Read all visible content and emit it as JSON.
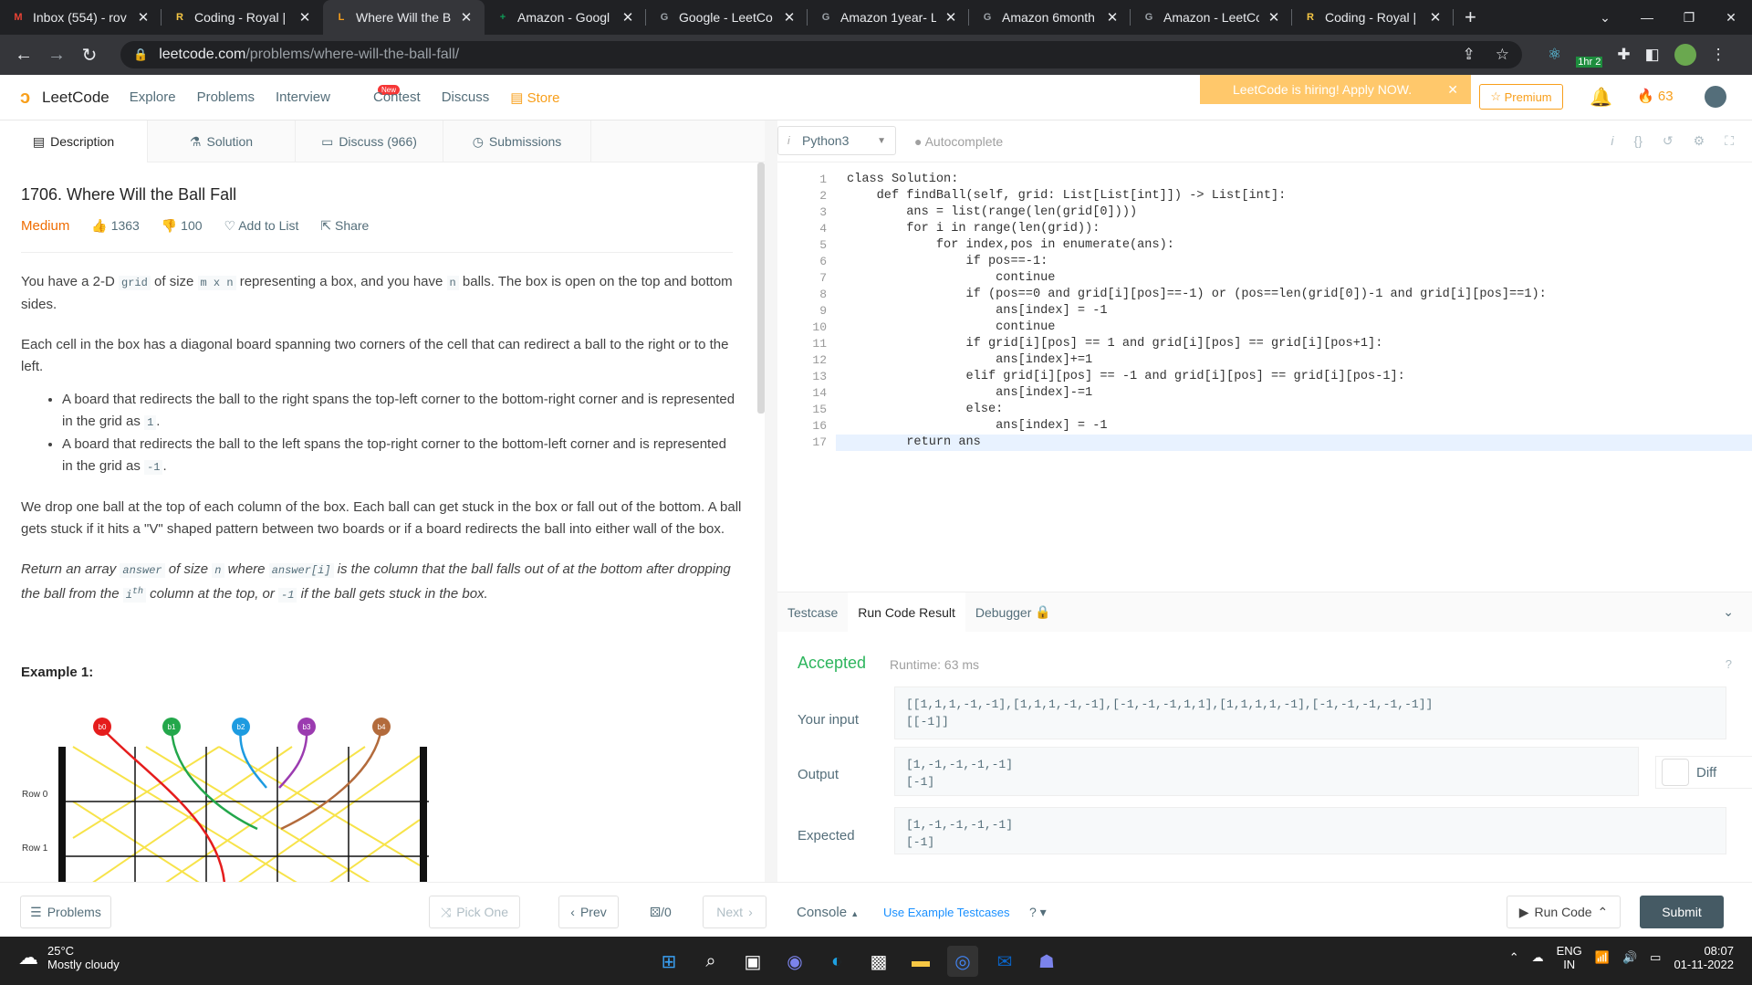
{
  "browser": {
    "tabs": [
      {
        "title": "Inbox (554) - rov",
        "icon": "M",
        "color": "#ea4335"
      },
      {
        "title": "Coding - Royal | ",
        "icon": "R",
        "color": "#f6c744"
      },
      {
        "title": "Where Will the B",
        "icon": "L",
        "color": "#f89f1b"
      },
      {
        "title": "Amazon - Googl",
        "icon": "+",
        "color": "#0f9d58"
      },
      {
        "title": "Google - LeetCo",
        "icon": "G",
        "color": "#9aa0a6"
      },
      {
        "title": "Amazon 1year- L",
        "icon": "G",
        "color": "#9aa0a6"
      },
      {
        "title": "Amazon 6month",
        "icon": "G",
        "color": "#9aa0a6"
      },
      {
        "title": "Amazon - LeetCo",
        "icon": "G",
        "color": "#9aa0a6"
      },
      {
        "title": "Coding - Royal | ",
        "icon": "R",
        "color": "#f6c744"
      }
    ],
    "url_host": "leetcode.com",
    "url_path": "/problems/where-will-the-ball-fall/",
    "ext_badge": "1hr 2"
  },
  "nav": {
    "logo": "LeetCode",
    "links": [
      "Explore",
      "Problems",
      "Interview",
      "Contest",
      "Discuss"
    ],
    "new_badge": "New",
    "store": "Store",
    "hiring": "LeetCode is hiring! Apply NOW.",
    "premium": "Premium",
    "streak": "63"
  },
  "desc_tabs": [
    "Description",
    "Solution",
    "Discuss (966)",
    "Submissions"
  ],
  "problem": {
    "title": "1706. Where Will the Ball Fall",
    "difficulty": "Medium",
    "likes": "1363",
    "dislikes": "100",
    "add_to_list": "Add to List",
    "share": "Share",
    "p1a": "You have a 2-D ",
    "p1_grid": "grid",
    "p1b": " of size ",
    "p1_mn": "m x n",
    "p1c": " representing a box, and you have ",
    "p1_n": "n",
    "p1d": " balls. The box is open on the top and bottom sides.",
    "p2": "Each cell in the box has a diagonal board spanning two corners of the cell that can redirect a ball to the right or to the left.",
    "b1": "A board that redirects the ball to the right spans the top-left corner to the bottom-right corner and is represented in the grid as ",
    "b1_code": "1",
    "b2": "A board that redirects the ball to the left spans the top-right corner to the bottom-left corner and is represented in the grid as ",
    "b2_code": "-1",
    "p3": "We drop one ball at the top of each column of the box. Each ball can get stuck in the box or fall out of the bottom. A ball gets stuck if it hits a \"V\" shaped pattern between two boards or if a board redirects the ball into either wall of the box.",
    "p4a": "Return an array ",
    "p4_answer": "answer",
    "p4b": " of size ",
    "p4_n": "n",
    "p4c": " where ",
    "p4_ansi": "answer[i]",
    "p4d": " is the column that the ball falls out of at the bottom after dropping the ball from the ",
    "p4_i": "i",
    "p4_th": "th",
    "p4e": " column at the top, or ",
    "p4_m1": "-1",
    "p4f": " if the ball gets stuck in the box.",
    "example": "Example 1:",
    "balls": [
      "b0",
      "b1",
      "b2",
      "b3",
      "b4"
    ],
    "row0": "Row 0",
    "row1": "Row 1"
  },
  "editor": {
    "language": "Python3",
    "autocomplete": "Autocomplete",
    "lines": [
      "class Solution:",
      "    def findBall(self, grid: List[List[int]]) -> List[int]:",
      "        ans = list(range(len(grid[0])))",
      "        for i in range(len(grid)):",
      "            for index,pos in enumerate(ans):",
      "                if pos==-1:",
      "                    continue",
      "                if (pos==0 and grid[i][pos]==-1) or (pos==len(grid[0])-1 and grid[i][pos]==1):",
      "                    ans[index] = -1",
      "                    continue",
      "                if grid[i][pos] == 1 and grid[i][pos] == grid[i][pos+1]:",
      "                    ans[index]+=1",
      "                elif grid[i][pos] == -1 and grid[i][pos] == grid[i][pos-1]:",
      "                    ans[index]-=1",
      "                else:",
      "                    ans[index] = -1",
      "        return ans"
    ],
    "line_numbers": [
      "1",
      "2",
      "3",
      "4",
      "5",
      "6",
      "7",
      "8",
      "9",
      "10",
      "11",
      "12",
      "13",
      "14",
      "15",
      "16",
      "17"
    ]
  },
  "console": {
    "tabs": [
      "Testcase",
      "Run Code Result",
      "Debugger"
    ],
    "status": "Accepted",
    "runtime": "Runtime: 63 ms",
    "input_label": "Your input",
    "input_value": "[[1,1,1,-1,-1],[1,1,1,-1,-1],[-1,-1,-1,1,1],[1,1,1,1,-1],[-1,-1,-1,-1,-1]]\n[[-1]]",
    "output_label": "Output",
    "output_value": "[1,-1,-1,-1,-1]\n[-1]",
    "expected_label": "Expected",
    "expected_value": "[1,-1,-1,-1,-1]\n[-1]",
    "diff": "Diff"
  },
  "bottom": {
    "problems": "Problems",
    "pick_one": "Pick One",
    "prev": "Prev",
    "counter": "/0",
    "next": "Next",
    "console": "Console",
    "use_example": "Use Example Testcases",
    "run_code": "Run Code",
    "submit": "Submit"
  },
  "taskbar": {
    "temp": "25°C",
    "weather": "Mostly cloudy",
    "lang1": "ENG",
    "lang2": "IN",
    "time": "08:07",
    "date": "01-11-2022"
  }
}
